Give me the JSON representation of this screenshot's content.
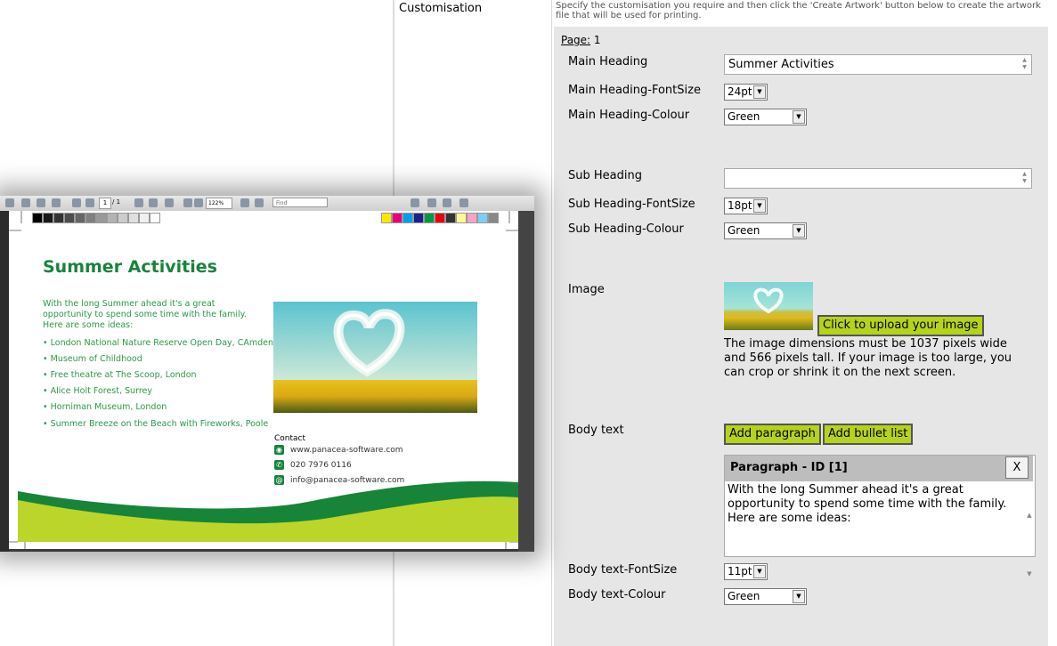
{
  "panel": {
    "section_label": "Customisation",
    "instructions": "Specify the customisation you require and then click the 'Create Artwork' button below to create the artwork file that will be used for printing.",
    "page_label": "Page:",
    "page_number": "1"
  },
  "fields": {
    "main_heading": {
      "label": "Main Heading",
      "value": "Summer Activities"
    },
    "main_heading_fontsize": {
      "label": "Main Heading-FontSize",
      "value": "24pt"
    },
    "main_heading_colour": {
      "label": "Main Heading-Colour",
      "value": "Green"
    },
    "sub_heading": {
      "label": "Sub Heading",
      "value": ""
    },
    "sub_heading_fontsize": {
      "label": "Sub Heading-FontSize",
      "value": "18pt"
    },
    "sub_heading_colour": {
      "label": "Sub Heading-Colour",
      "value": "Green"
    },
    "image": {
      "label": "Image",
      "upload_button": "Click to upload your image",
      "note": "The image dimensions must be 1037 pixels wide and 566 pixels tall. If your image is too large, you can crop or shrink it on the next screen."
    },
    "body_text": {
      "label": "Body text",
      "add_paragraph": "Add paragraph",
      "add_bullet_list": "Add bullet list",
      "paragraph_title": "Paragraph - ID [1]",
      "paragraph_close": "X",
      "paragraph_value": "With the long Summer ahead it's a great opportunity to spend some time with the family. Here are some ideas:"
    },
    "body_text_fontsize": {
      "label": "Body text-FontSize",
      "value": "11pt"
    },
    "body_text_colour": {
      "label": "Body text-Colour",
      "value": "Green"
    }
  },
  "viewer": {
    "page_current": "1",
    "page_total": "/ 1",
    "zoom": "122%",
    "find_placeholder": "Find",
    "colors": {
      "accent_green": "#17843a",
      "lime": "#bcd52a"
    }
  },
  "preview": {
    "heading": "Summer Activities",
    "intro": "With the long Summer ahead it's a great opportunity to spend some time with the family. Here are some ideas:",
    "bullets": [
      "London National Nature Reserve Open Day, CAmden",
      "Museum of Childhood",
      "Free theatre at The Scoop, London",
      "Alice Holt Forest, Surrey",
      "Horniman Museum, London",
      "Summer Breeze on the Beach with Fireworks, Poole"
    ],
    "contact_title": "Contact",
    "contact_web": "www.panacea-software.com",
    "contact_phone": "020 7976 0116",
    "contact_email": "info@panacea-software.com"
  }
}
